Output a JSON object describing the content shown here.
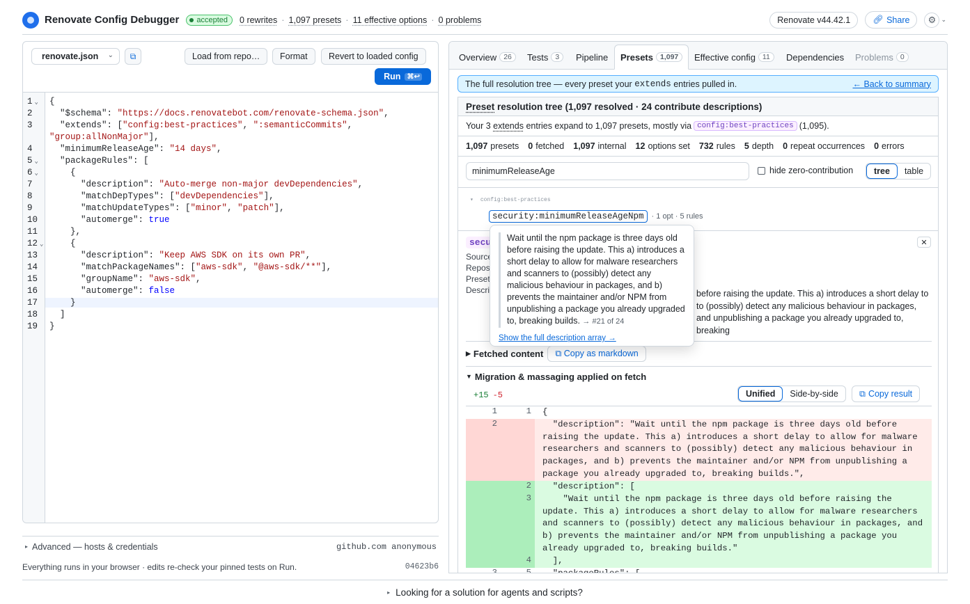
{
  "header": {
    "title": "Renovate Config Debugger",
    "status": "accepted",
    "stats": [
      "0 rewrites",
      "1,097 presets",
      "11 effective options",
      "0 problems"
    ],
    "version_label": "Renovate v44.42.1",
    "share_label": "Share"
  },
  "editor": {
    "file": "renovate.json",
    "load_label": "Load from repo…",
    "format_label": "Format",
    "revert_label": "Revert to loaded config",
    "run_label": "Run",
    "run_shortcut": "⌘↩",
    "line_numbers": [
      "1",
      "2",
      "3",
      "",
      "4",
      "5",
      "6",
      "7",
      "8",
      "9",
      "10",
      "11",
      "12",
      "13",
      "14",
      "15",
      "16",
      "17",
      "18",
      "19"
    ],
    "advanced_label": "Advanced — hosts & credentials",
    "advanced_value": "github.com anonymous",
    "footer_text": "Everything runs in your browser · edits re-check your pinned tests on Run.",
    "footer_hash": "04623b6"
  },
  "bottom_label": "Looking for a solution for agents and scripts?",
  "tabs": [
    {
      "label": "Overview",
      "count": "26"
    },
    {
      "label": "Tests",
      "count": "3"
    },
    {
      "label": "Pipeline",
      "count": ""
    },
    {
      "label": "Presets",
      "count": "1,097"
    },
    {
      "label": "Effective config",
      "count": "11"
    },
    {
      "label": "Dependencies",
      "count": ""
    },
    {
      "label": "Problems",
      "count": "0"
    }
  ],
  "banner": {
    "pre": "The full resolution tree — every preset your",
    "code": "extends",
    "post": "entries pulled in.",
    "link": "← Back to summary"
  },
  "presets": {
    "title_word": "Preset",
    "title_rest": "resolution tree (1,097 resolved · 24 contribute descriptions)",
    "summary_pre": "Your 3",
    "summary_extends": "extends",
    "summary_mid": "entries expand to 1,097 presets, mostly via",
    "summary_tag": "config:best-practices",
    "summary_post": "(1,095).",
    "stats": [
      {
        "v": "1,097",
        "l": "presets"
      },
      {
        "v": "0",
        "l": "fetched"
      },
      {
        "v": "1,097",
        "l": "internal"
      },
      {
        "v": "12",
        "l": "options set"
      },
      {
        "v": "732",
        "l": "rules"
      },
      {
        "v": "5",
        "l": "depth"
      },
      {
        "v": "0",
        "l": "repeat occurrences"
      },
      {
        "v": "0",
        "l": "errors"
      }
    ],
    "filter_value": "minimumReleaseAge",
    "hide_zero_label": "hide zero-contribution",
    "view_tree": "tree",
    "view_table": "table",
    "root_node": "config:best-practices",
    "child_node": "security:minimumReleaseAgeNpm",
    "child_meta": "· 1 opt · 5 rules",
    "detail_name": "secu",
    "detail_keys": [
      "Source",
      "Repos",
      "Preset",
      "Descri"
    ],
    "detail_desc": "before raising the update. This a) introduces a short delay to to (possibly) detect any malicious behaviour in packages, and unpublishing a package you already upgraded to, breaking",
    "fetched_label": "Fetched content",
    "copy_md_label": "Copy as markdown",
    "migration_label": "Migration & massaging applied on fetch",
    "plus": "+15",
    "minus": "-5",
    "unified": "Unified",
    "side_by_side": "Side-by-side",
    "copy_result": "Copy result"
  },
  "tooltip": {
    "text": "Wait until the npm package is three days old before raising the update. This a) introduces a short delay to allow for malware researchers and scanners to (possibly) detect any malicious behaviour in packages, and b) prevents the maintainer and/or NPM from unpublishing a package you already upgraded to, breaking builds.",
    "ref": "→ #21 of 24",
    "link": "Show the full description array →"
  },
  "diff": [
    {
      "kind": "ctx",
      "a": "1",
      "b": "1",
      "text": "{"
    },
    {
      "kind": "del",
      "a": "2",
      "b": "",
      "text": "  \"description\": \"Wait until the npm package is three days old before raising the update. This a) introduces a short delay to allow for malware researchers and scanners to (possibly) detect any malicious behaviour in packages, and b) prevents the maintainer and/or NPM from unpublishing a package you already upgraded to, breaking builds.\","
    },
    {
      "kind": "ins",
      "a": "",
      "b": "2",
      "text": "  \"description\": ["
    },
    {
      "kind": "ins",
      "a": "",
      "b": "3",
      "text": "    \"Wait until the npm package is three days old before raising the update. This a) introduces a short delay to allow for malware researchers and scanners to (possibly) detect any malicious behaviour in packages, and b) prevents the maintainer and/or NPM from unpublishing a package you already upgraded to, breaking builds.\""
    },
    {
      "kind": "ins",
      "a": "",
      "b": "4",
      "text": "  ],"
    },
    {
      "kind": "ctx",
      "a": "3",
      "b": "5",
      "text": "  \"packageRules\": ["
    }
  ]
}
